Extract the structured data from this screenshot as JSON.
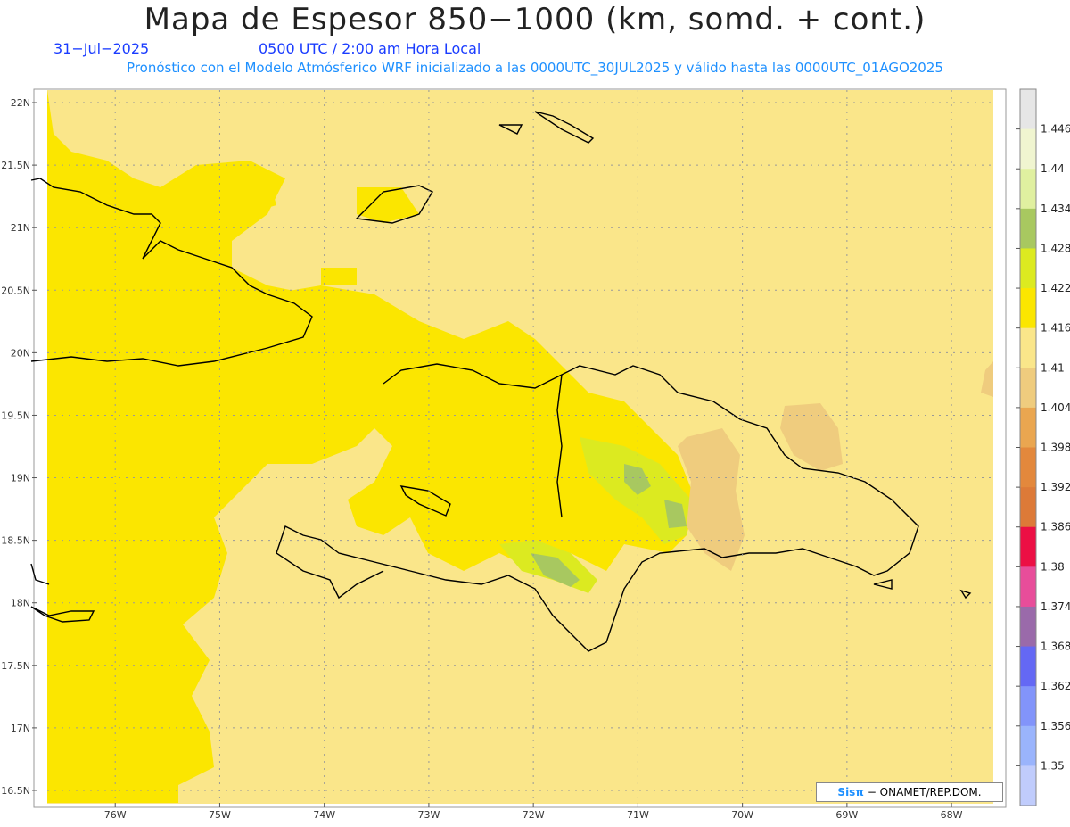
{
  "header": {
    "title": "Mapa de Espesor 850−1000 (km, somd. + cont.)",
    "date": "31−Jul−2025",
    "time": "0500 UTC / 2:00 am Hora Local",
    "forecast": "Pronóstico con el Modelo Atmósferico WRF inicializado a las 0000UTC_30JUL2025 y válido hasta las  0000UTC_01AGO2025"
  },
  "axes": {
    "lat_labels": [
      "22N",
      "21.5N",
      "21N",
      "20.5N",
      "20N",
      "19.5N",
      "19N",
      "18.5N",
      "18N",
      "17.5N",
      "17N",
      "16.5N"
    ],
    "lon_labels": [
      "76W",
      "75W",
      "74W",
      "73W",
      "72W",
      "71W",
      "70W",
      "69W",
      "68W"
    ],
    "lat_range": [
      16.4,
      22.1
    ],
    "lon_range": [
      -76.65,
      -67.6
    ],
    "grid": true
  },
  "colorbar": {
    "labels": [
      "1.446",
      "1.44",
      "1.434",
      "1.428",
      "1.422",
      "1.416",
      "1.41",
      "1.404",
      "1.398",
      "1.392",
      "1.386",
      "1.38",
      "1.374",
      "1.368",
      "1.362",
      "1.356",
      "1.35"
    ],
    "colors": [
      "#e6e6e6",
      "#f0f5d0",
      "#e0f0a0",
      "#a8c860",
      "#dcea20",
      "#fbe600",
      "#fae68a",
      "#efcc7e",
      "#eaa650",
      "#e3883c",
      "#dd7a38",
      "#ec0f44",
      "#e84d9a",
      "#9a6aaa",
      "#6468f4",
      "#8294fa",
      "#9ab4fc",
      "#c0ccfc"
    ]
  },
  "credit": {
    "logo": "Sisπ",
    "text": "− ONAMET/REP.DOM."
  }
}
